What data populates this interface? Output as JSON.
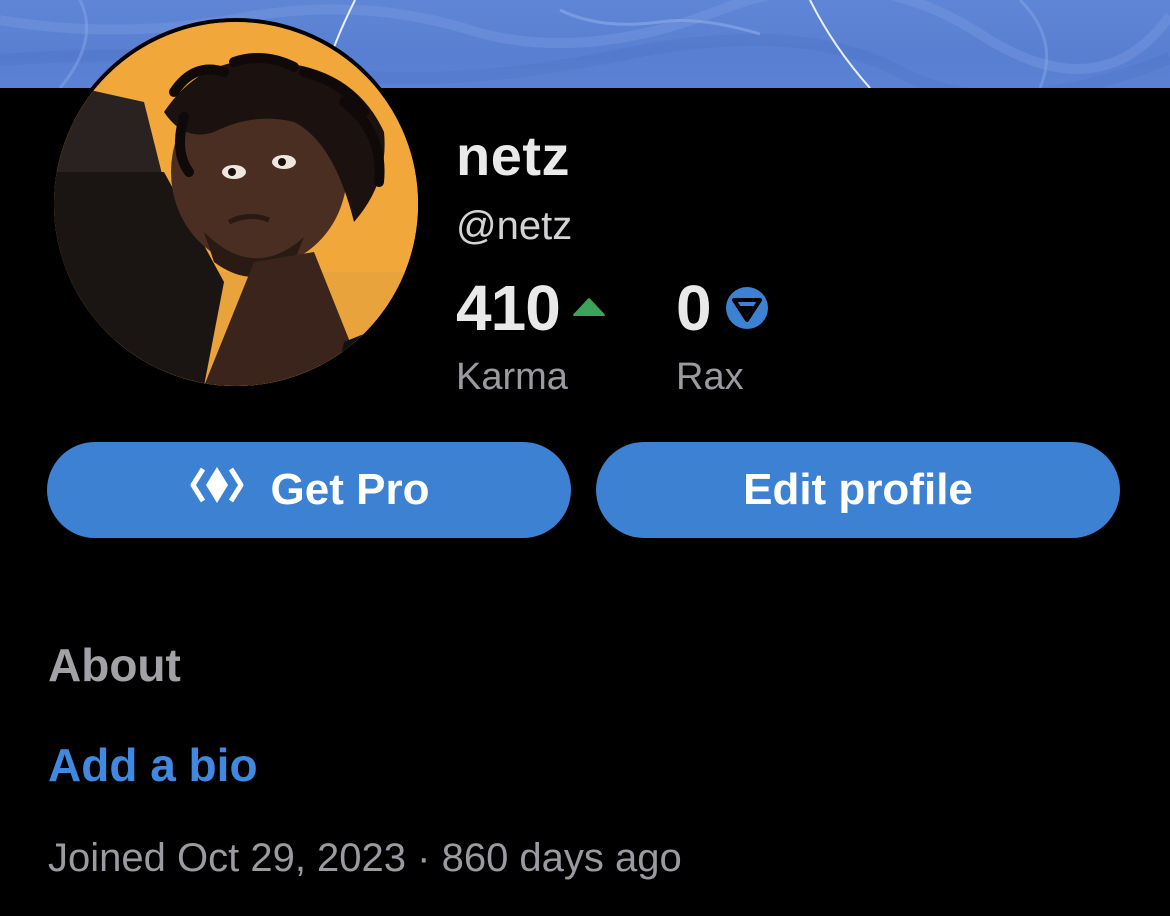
{
  "colors": {
    "background": "#000000",
    "banner": "#5a82d4",
    "button": "#3d81d2",
    "link": "#3f8ae0",
    "karma_up": "#3aa55a",
    "rax_icon": "#3d81d2"
  },
  "profile": {
    "display_name": "netz",
    "handle": "@netz",
    "avatar_icon": "user-avatar-photo"
  },
  "stats": {
    "karma": {
      "value": "410",
      "label": "Karma",
      "icon": "upvote-triangle-icon"
    },
    "rax": {
      "value": "0",
      "label": "Rax",
      "icon": "rax-coin-icon"
    }
  },
  "actions": {
    "get_pro_label": "Get Pro",
    "get_pro_icon": "pro-diamond-icon",
    "edit_profile_label": "Edit profile"
  },
  "about": {
    "heading": "About",
    "add_bio_link": "Add a bio",
    "joined_text": "Joined Oct 29, 2023 · 860 days ago"
  }
}
